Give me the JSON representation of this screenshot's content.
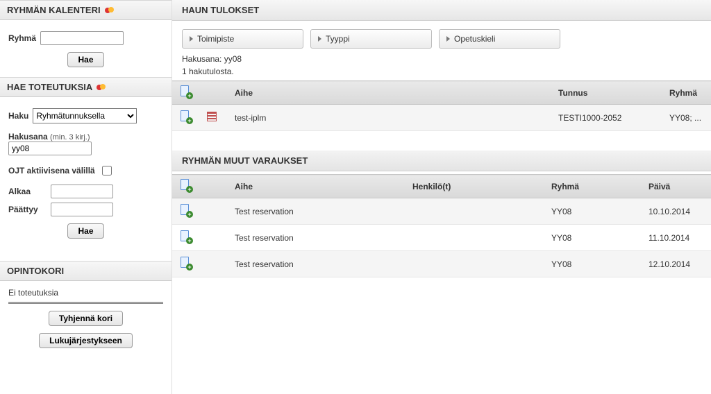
{
  "sidebar": {
    "calendar": {
      "title": "RYHMÄN KALENTERI",
      "group_label": "Ryhmä",
      "group_value": "",
      "search_btn": "Hae"
    },
    "search_impl": {
      "title": "HAE TOTEUTUKSIA",
      "haku_label": "Haku",
      "haku_selected": "Ryhmätunnuksella",
      "hakusana_label": "Hakusana",
      "hakusana_hint": "(min. 3 kirj.)",
      "hakusana_value": "yy08",
      "ojt_label": "OJT aktiivisena välillä",
      "ojt_checked": false,
      "alkaa_label": "Alkaa",
      "alkaa_value": "",
      "paattyy_label": "Päättyy",
      "paattyy_value": "",
      "search_btn": "Hae"
    },
    "cart": {
      "title": "OPINTOKORI",
      "empty_text": "Ei toteutuksia",
      "empty_btn": "Tyhjennä kori",
      "schedule_btn": "Lukujärjestykseen"
    }
  },
  "results": {
    "title": "HAUN TULOKSET",
    "filters": [
      "Toimipiste",
      "Tyyppi",
      "Opetuskieli"
    ],
    "hakusana_line": "Hakusana: yy08",
    "count_line": "1 hakutulosta.",
    "columns": {
      "aihe": "Aihe",
      "tunnus": "Tunnus",
      "ryhma": "Ryhmä"
    },
    "rows": [
      {
        "aihe": "test-iplm",
        "tunnus": "TESTI1000-2052",
        "ryhma": "YY08; ..."
      }
    ]
  },
  "other": {
    "title": "RYHMÄN MUUT VARAUKSET",
    "columns": {
      "aihe": "Aihe",
      "henkilot": "Henkilö(t)",
      "ryhma": "Ryhmä",
      "paiva": "Päivä"
    },
    "rows": [
      {
        "aihe": "Test reservation",
        "henkilot": "",
        "ryhma": "YY08",
        "paiva": "10.10.2014"
      },
      {
        "aihe": "Test reservation",
        "henkilot": "",
        "ryhma": "YY08",
        "paiva": "11.10.2014"
      },
      {
        "aihe": "Test reservation",
        "henkilot": "",
        "ryhma": "YY08",
        "paiva": "12.10.2014"
      }
    ]
  }
}
